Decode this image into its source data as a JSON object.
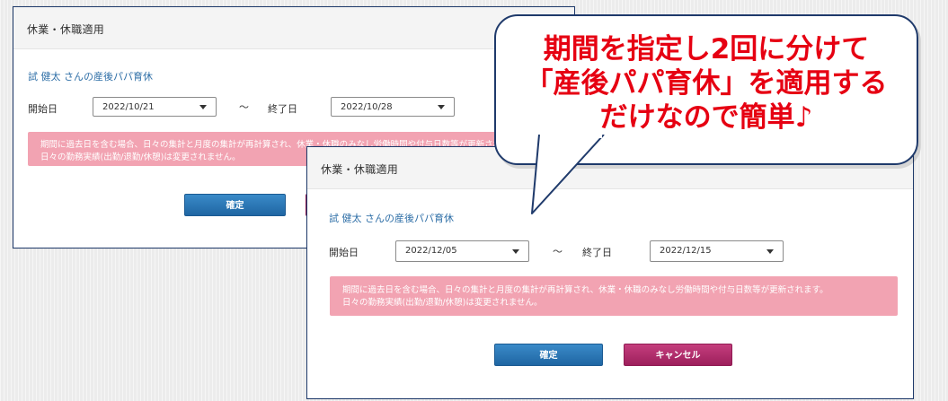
{
  "dialog_back": {
    "title": "休業・休職適用",
    "name_line": "試 健太 さんの産後パパ育休",
    "start_label": "開始日",
    "start_date": "2022/10/21",
    "tilde": "〜",
    "end_label": "終了日",
    "end_date": "2022/10/28",
    "warning_line1": "期間に過去日を含む場合、日々の集計と月度の集計が再計算され、休業・休職のみなし労働時間や付与日数等が更新されます。",
    "warning_line2": "日々の勤務実績(出勤/退勤/休憩)は変更されません。",
    "ok_label": "確定"
  },
  "dialog_front": {
    "title": "休業・休職適用",
    "name_line": "試 健太 さんの産後パパ育休",
    "start_label": "開始日",
    "start_date": "2022/12/05",
    "tilde": "〜",
    "end_label": "終了日",
    "end_date": "2022/12/15",
    "warning_line1": "期間に過去日を含む場合、日々の集計と月度の集計が再計算され、休業・休職のみなし労働時間や付与日数等が更新されます。",
    "warning_line2": "日々の勤務実績(出勤/退勤/休憩)は変更されません。",
    "ok_label": "確定",
    "cancel_label": "キャンセル"
  },
  "callout": {
    "line1": "期間を指定し2回に分けて",
    "line2": "「産後パパ育休」を適用する",
    "line3": "だけなので簡単♪",
    "text_color": "#e60012",
    "border_color": "#1f3a6b"
  },
  "colors": {
    "ok_button": "#2a78b9",
    "cancel_button": "#b02c6b",
    "warning_bg": "#f2a3b2",
    "link_text": "#2f6fa7"
  }
}
